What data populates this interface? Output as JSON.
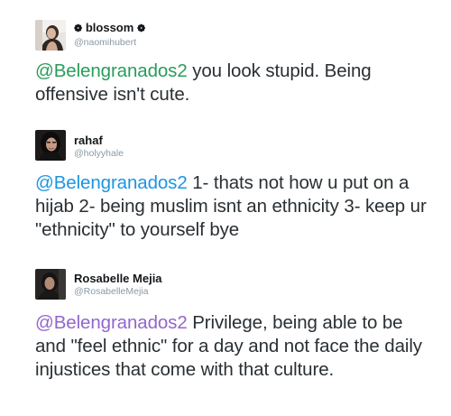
{
  "tweets": [
    {
      "name_prefix": "❁",
      "name": "blossom",
      "name_suffix": "❁",
      "handle": "@naomihubert",
      "mention": "@Belengranados2",
      "body": " you look stupid. Being offensive isn't cute.",
      "mention_color": "#2a9c5a"
    },
    {
      "name_prefix": "",
      "name": "rahaf",
      "name_suffix": "",
      "handle": "@holyyhale",
      "mention": "@Belengranados2",
      "body": " 1- thats not how u put on a hijab 2- being muslim isnt an ethnicity 3- keep ur \"ethnicity\" to yourself bye",
      "mention_color": "#1b95e0"
    },
    {
      "name_prefix": "",
      "name": "Rosabelle Mejia",
      "name_suffix": "",
      "handle": "@RosabelleMejia",
      "mention": "@Belengranados2",
      "body": " Privilege, being able to be and \"feel ethnic\" for a day and not face the daily injustices that come with that culture.",
      "mention_color": "#9266cc"
    }
  ]
}
